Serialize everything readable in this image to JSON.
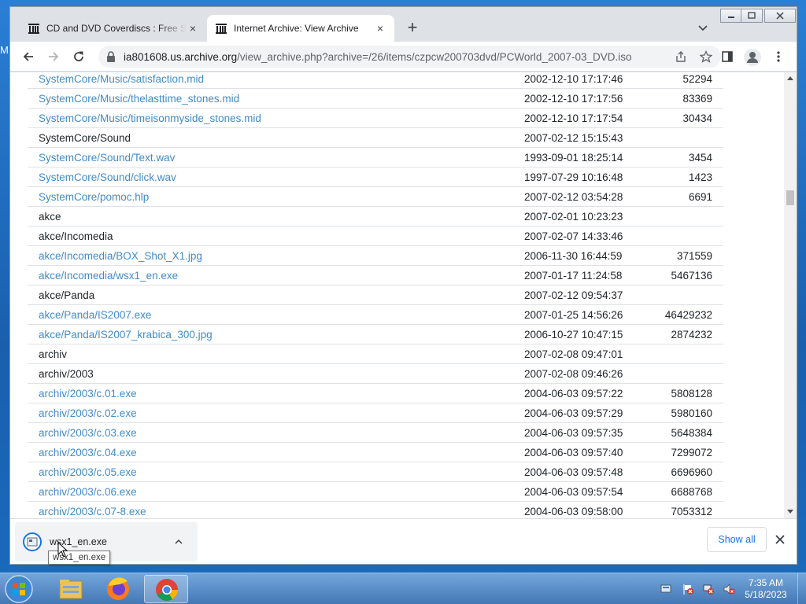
{
  "browser": {
    "tabs": [
      {
        "title": "CD and DVD Coverdiscs : Free Software",
        "active": false,
        "close": "×"
      },
      {
        "title": "Internet Archive: View Archive",
        "active": true,
        "close": "×"
      }
    ],
    "new_tab": "+",
    "url_host": "ia801608.us.archive.org",
    "url_path": "/view_archive.php?archive=/26/items/czpcw200703dvd/PCWorld_2007-03_DVD.iso"
  },
  "desktop_edge_text": "M",
  "colors": {
    "link": "#428bca",
    "text": "#212529",
    "accent": "#1a73e8"
  },
  "files": [
    {
      "name": "SystemCore/Music/satisfaction.mid",
      "date": "2002-12-10 17:17:46",
      "size": "52294",
      "link": true
    },
    {
      "name": "SystemCore/Music/thelasttime_stones.mid",
      "date": "2002-12-10 17:17:56",
      "size": "83369",
      "link": true
    },
    {
      "name": "SystemCore/Music/timeisonmyside_stones.mid",
      "date": "2002-12-10 17:17:54",
      "size": "30434",
      "link": true
    },
    {
      "name": "SystemCore/Sound",
      "date": "2007-02-12 15:15:43",
      "size": "",
      "link": false
    },
    {
      "name": "SystemCore/Sound/Text.wav",
      "date": "1993-09-01 18:25:14",
      "size": "3454",
      "link": true
    },
    {
      "name": "SystemCore/Sound/click.wav",
      "date": "1997-07-29 10:16:48",
      "size": "1423",
      "link": true
    },
    {
      "name": "SystemCore/pomoc.hlp",
      "date": "2007-02-12 03:54:28",
      "size": "6691",
      "link": true
    },
    {
      "name": "akce",
      "date": "2007-02-01 10:23:23",
      "size": "",
      "link": false
    },
    {
      "name": "akce/Incomedia",
      "date": "2007-02-07 14:33:46",
      "size": "",
      "link": false
    },
    {
      "name": "akce/Incomedia/BOX_Shot_X1.jpg",
      "date": "2006-11-30 16:44:59",
      "size": "371559",
      "link": true
    },
    {
      "name": "akce/Incomedia/wsx1_en.exe",
      "date": "2007-01-17 11:24:58",
      "size": "5467136",
      "link": true
    },
    {
      "name": "akce/Panda",
      "date": "2007-02-12 09:54:37",
      "size": "",
      "link": false
    },
    {
      "name": "akce/Panda/IS2007.exe",
      "date": "2007-01-25 14:56:26",
      "size": "46429232",
      "link": true
    },
    {
      "name": "akce/Panda/IS2007_krabica_300.jpg",
      "date": "2006-10-27 10:47:15",
      "size": "2874232",
      "link": true
    },
    {
      "name": "archiv",
      "date": "2007-02-08 09:47:01",
      "size": "",
      "link": false
    },
    {
      "name": "archiv/2003",
      "date": "2007-02-08 09:46:26",
      "size": "",
      "link": false
    },
    {
      "name": "archiv/2003/c.01.exe",
      "date": "2004-06-03 09:57:22",
      "size": "5808128",
      "link": true
    },
    {
      "name": "archiv/2003/c.02.exe",
      "date": "2004-06-03 09:57:29",
      "size": "5980160",
      "link": true
    },
    {
      "name": "archiv/2003/c.03.exe",
      "date": "2004-06-03 09:57:35",
      "size": "5648384",
      "link": true
    },
    {
      "name": "archiv/2003/c.04.exe",
      "date": "2004-06-03 09:57:40",
      "size": "7299072",
      "link": true
    },
    {
      "name": "archiv/2003/c.05.exe",
      "date": "2004-06-03 09:57:48",
      "size": "6696960",
      "link": true
    },
    {
      "name": "archiv/2003/c.06.exe",
      "date": "2004-06-03 09:57:54",
      "size": "6688768",
      "link": true
    },
    {
      "name": "archiv/2003/c.07-8.exe",
      "date": "2004-06-03 09:58:00",
      "size": "7053312",
      "link": true
    }
  ],
  "download_bar": {
    "filename": "wsx1_en.exe",
    "tooltip": "wsx1_en.exe",
    "show_all": "Show all"
  },
  "taskbar": {
    "apps": [
      "explorer-icon",
      "firefox-icon",
      "chrome-icon"
    ],
    "active_app": "chrome-icon",
    "time": "7:35 AM",
    "date": "5/18/2023"
  }
}
